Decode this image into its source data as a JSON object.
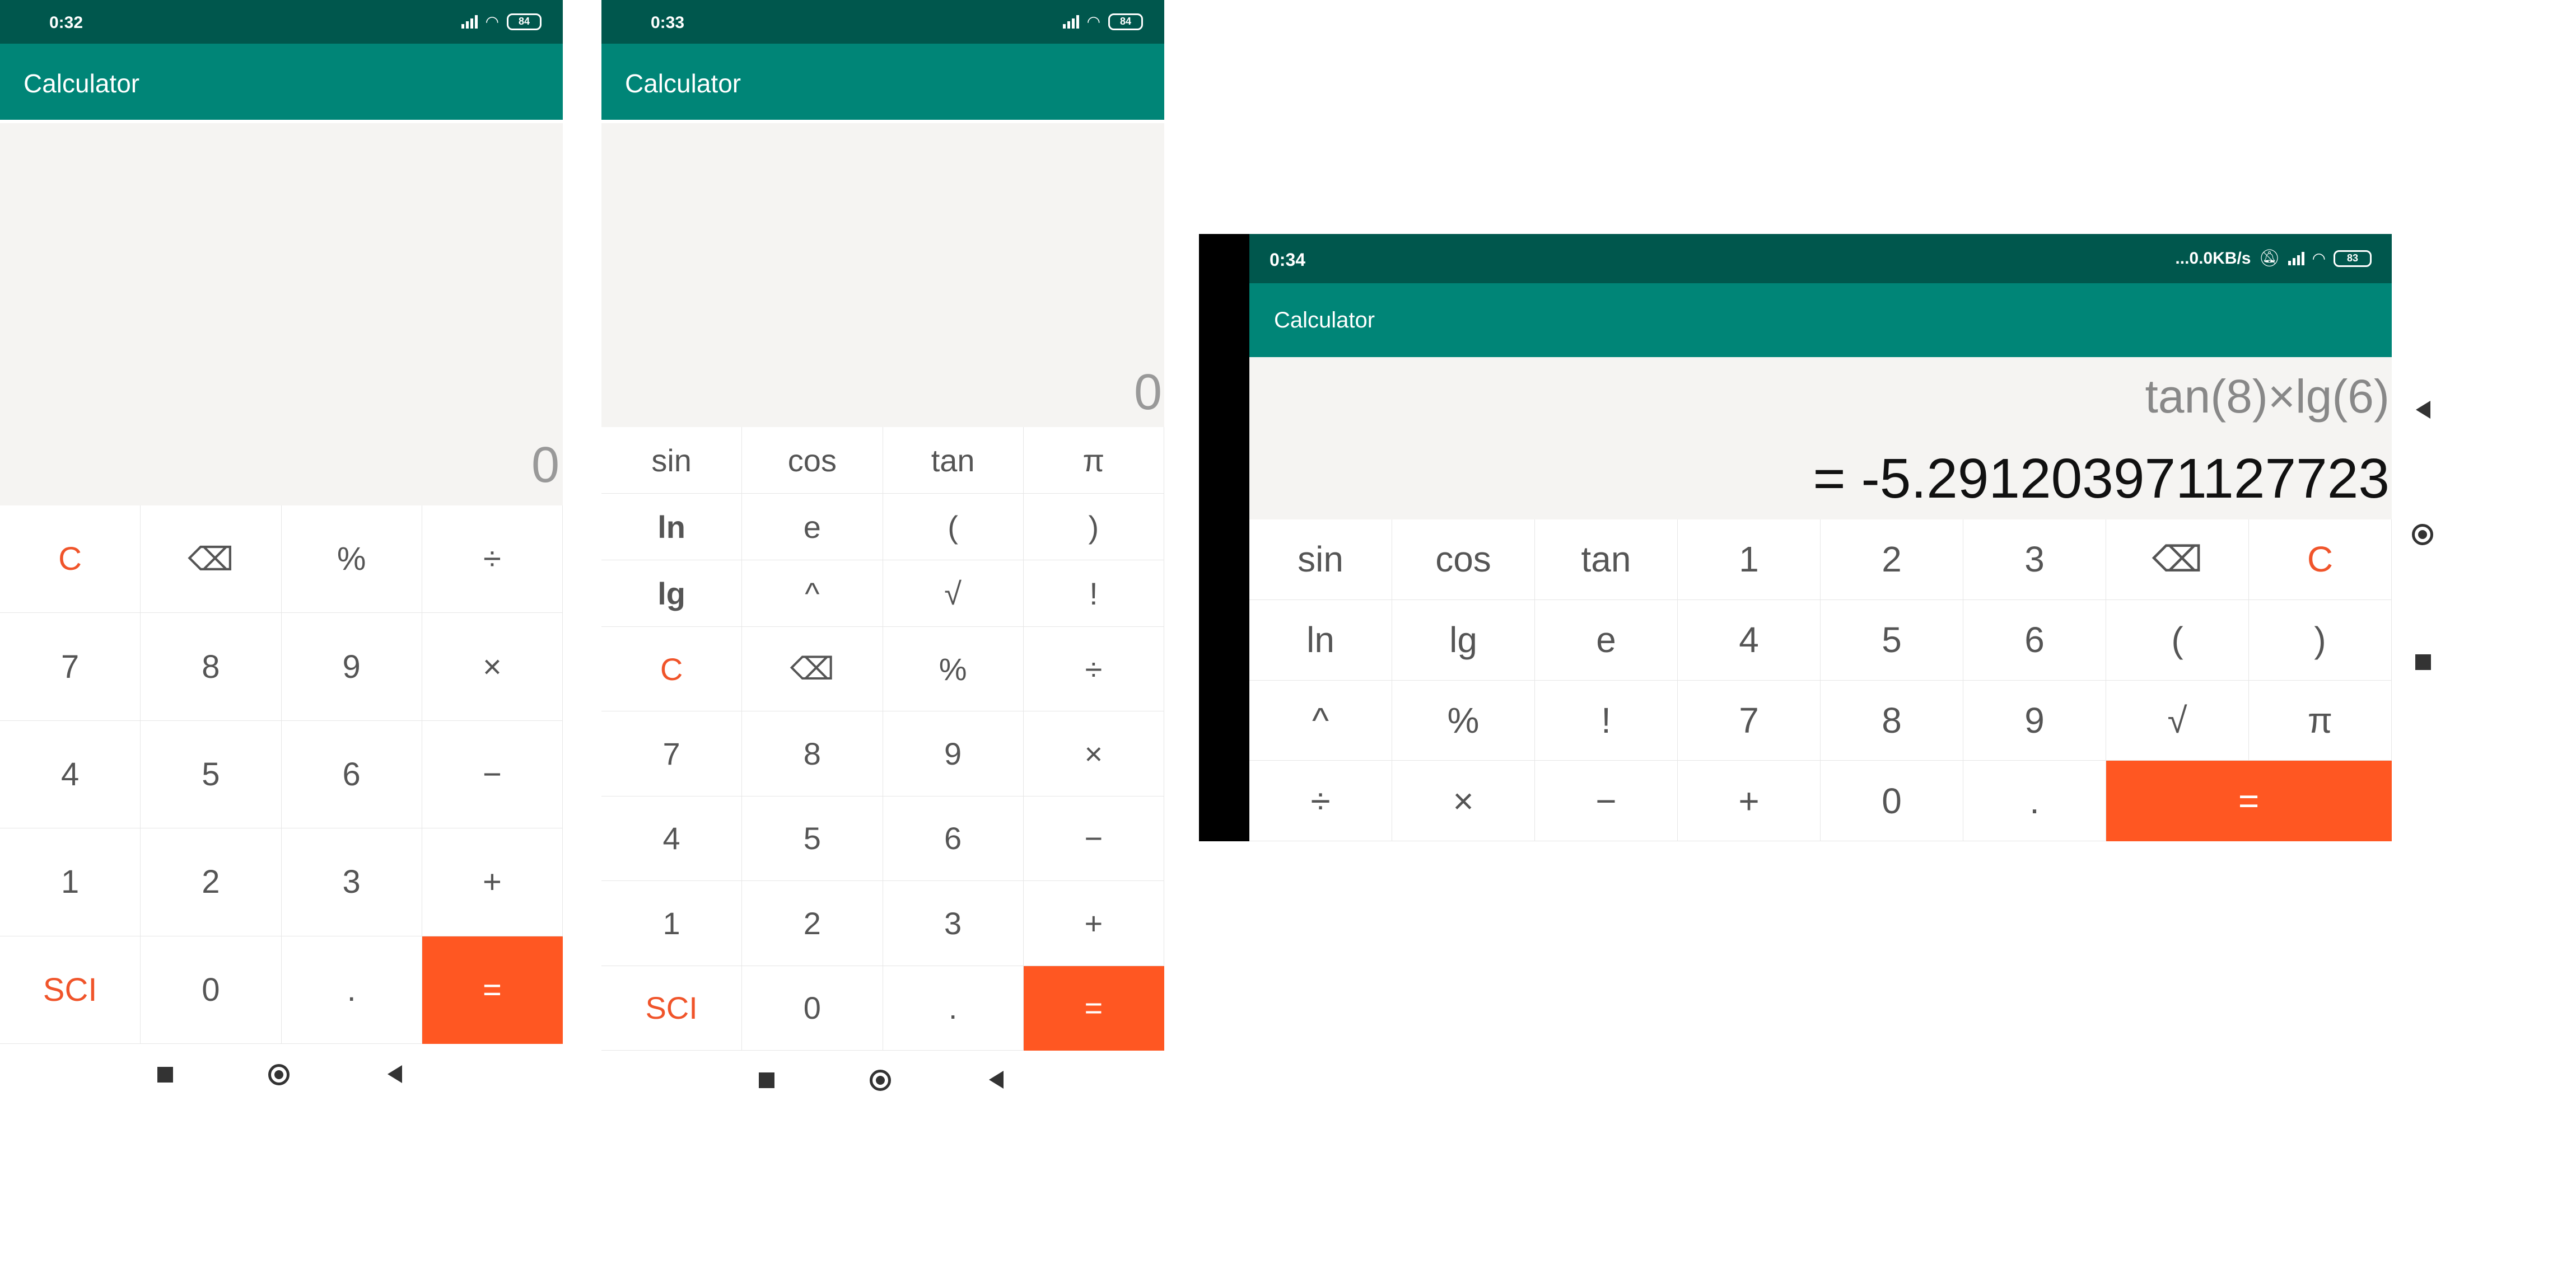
{
  "app": {
    "title": "Calculator"
  },
  "phone1": {
    "time": "0:32",
    "battery": "84",
    "display_value": "0",
    "keys": [
      {
        "label": "C",
        "style": "orange"
      },
      {
        "label": "⌫",
        "style": ""
      },
      {
        "label": "%",
        "style": ""
      },
      {
        "label": "÷",
        "style": ""
      },
      {
        "label": "7",
        "style": ""
      },
      {
        "label": "8",
        "style": ""
      },
      {
        "label": "9",
        "style": ""
      },
      {
        "label": "×",
        "style": ""
      },
      {
        "label": "4",
        "style": ""
      },
      {
        "label": "5",
        "style": ""
      },
      {
        "label": "6",
        "style": ""
      },
      {
        "label": "−",
        "style": ""
      },
      {
        "label": "1",
        "style": ""
      },
      {
        "label": "2",
        "style": ""
      },
      {
        "label": "3",
        "style": ""
      },
      {
        "label": "+",
        "style": ""
      },
      {
        "label": "SCI",
        "style": "orange"
      },
      {
        "label": "0",
        "style": ""
      },
      {
        "label": ".",
        "style": ""
      },
      {
        "label": "=",
        "style": "eq"
      }
    ]
  },
  "phone2": {
    "time": "0:33",
    "battery": "84",
    "display_value": "0",
    "sci_keys": [
      {
        "label": "sin",
        "style": ""
      },
      {
        "label": "cos",
        "style": ""
      },
      {
        "label": "tan",
        "style": ""
      },
      {
        "label": "π",
        "style": ""
      },
      {
        "label": "ln",
        "style": "bold"
      },
      {
        "label": "e",
        "style": ""
      },
      {
        "label": "(",
        "style": ""
      },
      {
        "label": ")",
        "style": ""
      },
      {
        "label": "lg",
        "style": "bold"
      },
      {
        "label": "^",
        "style": ""
      },
      {
        "label": "√",
        "style": ""
      },
      {
        "label": "!",
        "style": ""
      }
    ],
    "keys": [
      {
        "label": "C",
        "style": "orange"
      },
      {
        "label": "⌫",
        "style": ""
      },
      {
        "label": "%",
        "style": ""
      },
      {
        "label": "÷",
        "style": ""
      },
      {
        "label": "7",
        "style": ""
      },
      {
        "label": "8",
        "style": ""
      },
      {
        "label": "9",
        "style": ""
      },
      {
        "label": "×",
        "style": ""
      },
      {
        "label": "4",
        "style": ""
      },
      {
        "label": "5",
        "style": ""
      },
      {
        "label": "6",
        "style": ""
      },
      {
        "label": "−",
        "style": ""
      },
      {
        "label": "1",
        "style": ""
      },
      {
        "label": "2",
        "style": ""
      },
      {
        "label": "3",
        "style": ""
      },
      {
        "label": "+",
        "style": ""
      },
      {
        "label": "SCI",
        "style": "orange"
      },
      {
        "label": "0",
        "style": ""
      },
      {
        "label": ".",
        "style": ""
      },
      {
        "label": "=",
        "style": "eq"
      }
    ]
  },
  "phone3": {
    "time": "0:34",
    "net_speed": "...0.0KB/s",
    "battery": "83",
    "expression": "tan(8)×lg(6)",
    "result": "= -5.291203971127723",
    "keys": [
      {
        "label": "sin",
        "style": ""
      },
      {
        "label": "cos",
        "style": ""
      },
      {
        "label": "tan",
        "style": ""
      },
      {
        "label": "1",
        "style": ""
      },
      {
        "label": "2",
        "style": ""
      },
      {
        "label": "3",
        "style": ""
      },
      {
        "label": "⌫",
        "style": ""
      },
      {
        "label": "C",
        "style": "orange"
      },
      {
        "label": "ln",
        "style": ""
      },
      {
        "label": "lg",
        "style": ""
      },
      {
        "label": "e",
        "style": ""
      },
      {
        "label": "4",
        "style": ""
      },
      {
        "label": "5",
        "style": ""
      },
      {
        "label": "6",
        "style": ""
      },
      {
        "label": "(",
        "style": ""
      },
      {
        "label": ")",
        "style": ""
      },
      {
        "label": "^",
        "style": ""
      },
      {
        "label": "%",
        "style": ""
      },
      {
        "label": "!",
        "style": ""
      },
      {
        "label": "7",
        "style": ""
      },
      {
        "label": "8",
        "style": ""
      },
      {
        "label": "9",
        "style": ""
      },
      {
        "label": "√",
        "style": ""
      },
      {
        "label": "π",
        "style": ""
      },
      {
        "label": "÷",
        "style": ""
      },
      {
        "label": "×",
        "style": ""
      },
      {
        "label": "−",
        "style": ""
      },
      {
        "label": "+",
        "style": ""
      },
      {
        "label": "0",
        "style": ""
      },
      {
        "label": ".",
        "style": ""
      },
      {
        "label": "=",
        "style": "eq"
      }
    ]
  },
  "colors": {
    "status_bar": "#00574d",
    "app_bar": "#008577",
    "accent": "#ff5722",
    "accent_text": "#f0542a"
  }
}
